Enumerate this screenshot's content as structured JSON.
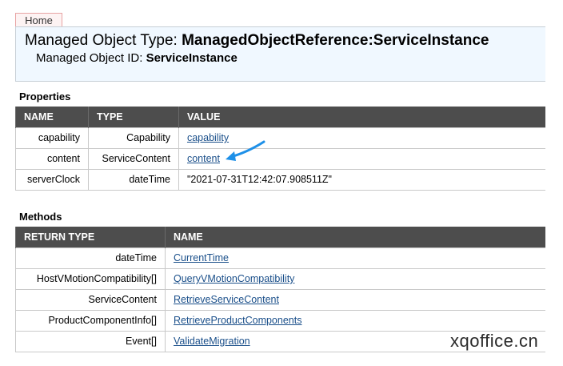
{
  "nav": {
    "home_label": "Home"
  },
  "header": {
    "type_label": "Managed Object Type:",
    "type_value": "ManagedObjectReference:ServiceInstance",
    "id_label": "Managed Object ID:",
    "id_value": "ServiceInstance"
  },
  "properties": {
    "title": "Properties",
    "columns": [
      "NAME",
      "TYPE",
      "VALUE"
    ],
    "rows": [
      {
        "name": "capability",
        "type": "Capability",
        "value": "capability",
        "value_is_link": true
      },
      {
        "name": "content",
        "type": "ServiceContent",
        "value": "content",
        "value_is_link": true
      },
      {
        "name": "serverClock",
        "type": "dateTime",
        "value": "\"2021-07-31T12:42:07.908511Z\"",
        "value_is_link": false
      }
    ]
  },
  "methods": {
    "title": "Methods",
    "columns": [
      "RETURN TYPE",
      "NAME"
    ],
    "rows": [
      {
        "return_type": "dateTime",
        "name": "CurrentTime"
      },
      {
        "return_type": "HostVMotionCompatibility[]",
        "name": "QueryVMotionCompatibility"
      },
      {
        "return_type": "ServiceContent",
        "name": "RetrieveServiceContent"
      },
      {
        "return_type": "ProductComponentInfo[]",
        "name": "RetrieveProductComponents"
      },
      {
        "return_type": "Event[]",
        "name": "ValidateMigration"
      }
    ]
  },
  "watermark": "xqoffice.cn",
  "annotation": {
    "icon": "arrow-icon",
    "color": "#1e90e8"
  },
  "colors": {
    "header_bg": "#f0f8ff",
    "table_header_bg": "#4d4d4d",
    "link": "#1a4f8a"
  }
}
